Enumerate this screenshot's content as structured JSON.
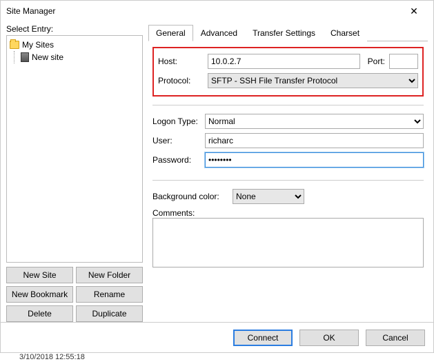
{
  "window": {
    "title": "Site Manager"
  },
  "left": {
    "label": "Select Entry:",
    "tree": {
      "root": "My Sites",
      "item": "New site"
    },
    "buttons": {
      "newSite": "New Site",
      "newFolder": "New Folder",
      "newBookmark": "New Bookmark",
      "rename": "Rename",
      "delete": "Delete",
      "duplicate": "Duplicate"
    }
  },
  "tabs": {
    "general": "General",
    "advanced": "Advanced",
    "transfer": "Transfer Settings",
    "charset": "Charset"
  },
  "general": {
    "hostLabel": "Host:",
    "hostValue": "10.0.2.7",
    "portLabel": "Port:",
    "portValue": "",
    "protocolLabel": "Protocol:",
    "protocolValue": "SFTP - SSH File Transfer Protocol",
    "logonTypeLabel": "Logon Type:",
    "logonTypeValue": "Normal",
    "userLabel": "User:",
    "userValue": "richarc",
    "passwordLabel": "Password:",
    "passwordValue": "••••••••",
    "bgColorLabel": "Background color:",
    "bgColorValue": "None",
    "commentsLabel": "Comments:",
    "commentsValue": ""
  },
  "footer": {
    "connect": "Connect",
    "ok": "OK",
    "cancel": "Cancel"
  },
  "status": "3/10/2018 12:55:18"
}
